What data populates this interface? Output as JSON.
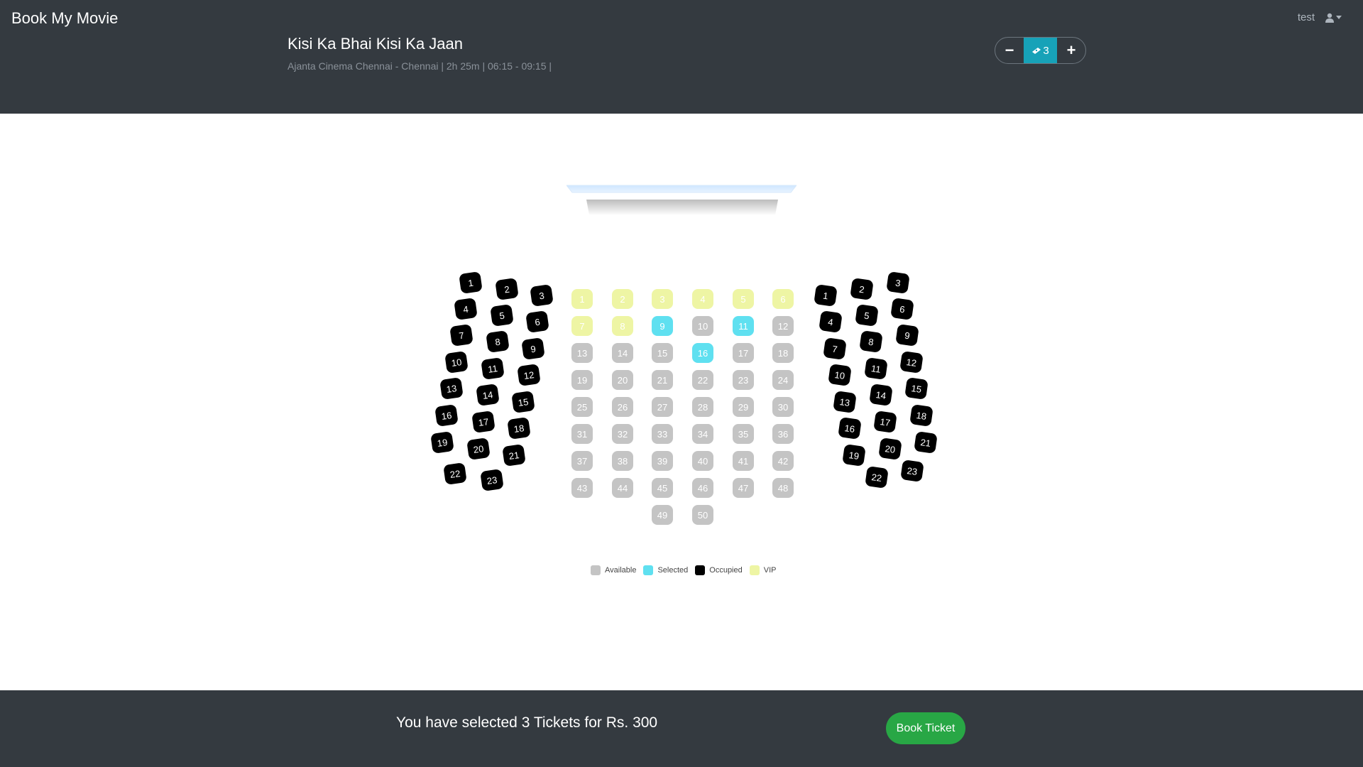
{
  "header": {
    "brand": "Book My Movie",
    "user_name": "test",
    "user_icon": "user-icon"
  },
  "movie": {
    "title": "Kisi Ka Bhai Kisi Ka Jaan",
    "info": "Ajanta Cinema Chennai - Chennai | 2h 25m |   06:15 - 09:15 |"
  },
  "ticket_counter": {
    "minus": "−",
    "plus": "+",
    "count": "3",
    "icon": "ticket-icon"
  },
  "colors": {
    "available": "#c4c4c4",
    "selected": "#5fe0f0",
    "occupied": "#000000",
    "vip": "#eef5a4",
    "accent": "#17a2b8",
    "book_button": "#28a745",
    "bar": "#343a40"
  },
  "seating": {
    "left_block": [
      "1",
      "2",
      "3",
      "4",
      "5",
      "6",
      "7",
      "8",
      "9",
      "10",
      "11",
      "12",
      "13",
      "14",
      "15",
      "16",
      "17",
      "18",
      "19",
      "20",
      "21",
      "22",
      "23"
    ],
    "center_block": [
      {
        "n": "1",
        "s": "vip"
      },
      {
        "n": "2",
        "s": "vip"
      },
      {
        "n": "3",
        "s": "vip"
      },
      {
        "n": "4",
        "s": "vip"
      },
      {
        "n": "5",
        "s": "vip"
      },
      {
        "n": "6",
        "s": "vip"
      },
      {
        "n": "7",
        "s": "vip"
      },
      {
        "n": "8",
        "s": "vip"
      },
      {
        "n": "9",
        "s": "selected"
      },
      {
        "n": "10",
        "s": "available"
      },
      {
        "n": "11",
        "s": "selected"
      },
      {
        "n": "12",
        "s": "available"
      },
      {
        "n": "13",
        "s": "available"
      },
      {
        "n": "14",
        "s": "available"
      },
      {
        "n": "15",
        "s": "available"
      },
      {
        "n": "16",
        "s": "selected"
      },
      {
        "n": "17",
        "s": "available"
      },
      {
        "n": "18",
        "s": "available"
      },
      {
        "n": "19",
        "s": "available"
      },
      {
        "n": "20",
        "s": "available"
      },
      {
        "n": "21",
        "s": "available"
      },
      {
        "n": "22",
        "s": "available"
      },
      {
        "n": "23",
        "s": "available"
      },
      {
        "n": "24",
        "s": "available"
      },
      {
        "n": "25",
        "s": "available"
      },
      {
        "n": "26",
        "s": "available"
      },
      {
        "n": "27",
        "s": "available"
      },
      {
        "n": "28",
        "s": "available"
      },
      {
        "n": "29",
        "s": "available"
      },
      {
        "n": "30",
        "s": "available"
      },
      {
        "n": "31",
        "s": "available"
      },
      {
        "n": "32",
        "s": "available"
      },
      {
        "n": "33",
        "s": "available"
      },
      {
        "n": "34",
        "s": "available"
      },
      {
        "n": "35",
        "s": "available"
      },
      {
        "n": "36",
        "s": "available"
      },
      {
        "n": "37",
        "s": "available"
      },
      {
        "n": "38",
        "s": "available"
      },
      {
        "n": "39",
        "s": "available"
      },
      {
        "n": "40",
        "s": "available"
      },
      {
        "n": "41",
        "s": "available"
      },
      {
        "n": "42",
        "s": "available"
      },
      {
        "n": "43",
        "s": "available"
      },
      {
        "n": "44",
        "s": "available"
      },
      {
        "n": "45",
        "s": "available"
      },
      {
        "n": "46",
        "s": "available"
      },
      {
        "n": "47",
        "s": "available"
      },
      {
        "n": "48",
        "s": "available"
      },
      {
        "n": "49",
        "s": "available"
      },
      {
        "n": "50",
        "s": "available"
      }
    ],
    "right_block": [
      "1",
      "2",
      "3",
      "4",
      "5",
      "6",
      "7",
      "8",
      "9",
      "10",
      "11",
      "12",
      "13",
      "14",
      "15",
      "16",
      "17",
      "18",
      "19",
      "20",
      "21",
      "22",
      "23"
    ]
  },
  "legend": [
    {
      "label": "Available",
      "state": "available"
    },
    {
      "label": "Selected",
      "state": "selected"
    },
    {
      "label": "Occupied",
      "state": "occupied"
    },
    {
      "label": "VIP",
      "state": "vip"
    }
  ],
  "footer": {
    "summary": "You have selected 3 Tickets for Rs. 300",
    "book_label": "Book Ticket"
  }
}
